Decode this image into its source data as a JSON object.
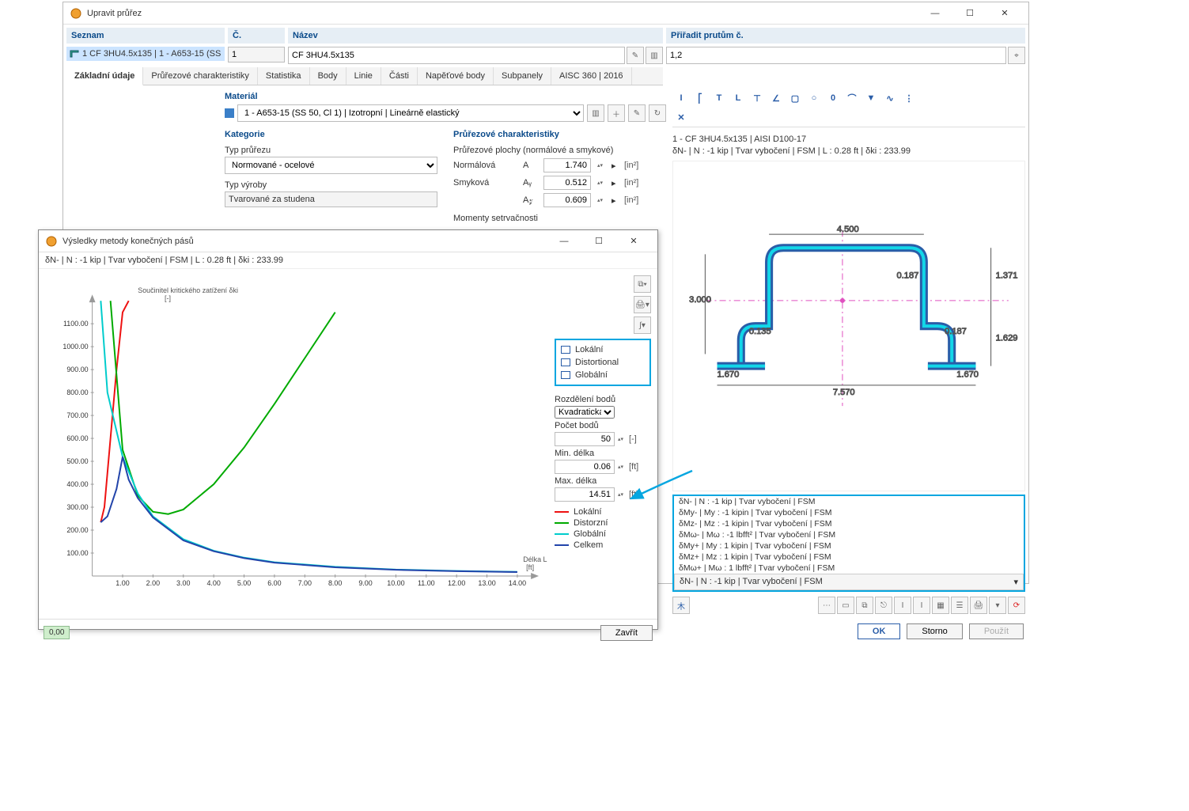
{
  "main_window": {
    "title": "Upravit průřez",
    "list_header": "Seznam",
    "list_item": "1  CF 3HU4.5x135 | 1 - A653-15 (SS",
    "number_header": "Č.",
    "number_value": "1",
    "name_header": "Název",
    "name_value": "CF 3HU4.5x135",
    "assign_header": "Přiřadit prutům č.",
    "assign_value": "1,2",
    "tabs": [
      "Základní údaje",
      "Průřezové charakteristiky",
      "Statistika",
      "Body",
      "Linie",
      "Části",
      "Napěťové body",
      "Subpanely",
      "AISC 360 | 2016"
    ],
    "material_label": "Materiál",
    "material_value": "1 - A653-15 (SS 50, Cl 1) | Izotropní | Lineárně elastický",
    "category_label": "Kategorie",
    "type_label": "Typ průřezu",
    "type_value": "Normované - ocelové",
    "manuf_label": "Typ výroby",
    "manuf_value": "Tvarované za studena",
    "props_label": "Průřezové charakteristiky",
    "areas_label": "Průřezové plochy (normálové a smykové)",
    "row_normal": "Normálová",
    "sym_A": "A",
    "val_A": "1.740",
    "row_shear": "Smyková",
    "sym_Ay": "Aᵧ",
    "val_Ay": "0.512",
    "sym_Az": "A𝓏",
    "val_Az": "0.609",
    "unit_in2": "[in²]",
    "inertia_label": "Momenty setrvačnosti",
    "section_info1": "1 - CF 3HU4.5x135 | AISI D100-17",
    "section_info2": "δN- | N : -1 kip | Tvar vybočení | FSM | L : 0.28 ft | δki : 233.99",
    "dim_top": "4.500",
    "dim_bottom": "7.570",
    "dim_left": "3.000",
    "dim_r1": "1.371",
    "dim_r2": "1.629",
    "dim_tA": "0.135",
    "dim_tB": "0.187",
    "dim_tC": "0.187",
    "dim_extL": "1.670",
    "dim_extR": "1.670",
    "results": [
      "δN- | N : -1 kip | Tvar vybočení | FSM",
      "δMy- | My : -1 kipin | Tvar vybočení | FSM",
      "δMz- | Mz : -1 kipin | Tvar vybočení | FSM",
      "δMω- | Mω : -1 lbfft² | Tvar vybočení | FSM",
      "δMy+ | My : 1 kipin | Tvar vybočení | FSM",
      "δMz+ | Mz : 1 kipin | Tvar vybočení | FSM",
      "δMω+ | Mω : 1 lbfft² | Tvar vybočení | FSM"
    ],
    "result_selected": "δN- | N : -1 kip | Tvar vybočení | FSM",
    "btn_ok": "OK",
    "btn_cancel": "Storno",
    "btn_apply": "Použít"
  },
  "fsm_window": {
    "title": "Výsledky metody konečných pásů",
    "subtitle": "δN- | N : -1 kip | Tvar vybočení | FSM | L : 0.28 ft | δki : 233.99",
    "y_axis_title": "Součinitel kritického zatížení δki",
    "y_unit": "[-]",
    "x_axis_title": "Délka L",
    "x_unit": "[ft]",
    "legend_modes": {
      "local": "Lokální",
      "distortional": "Distortional",
      "global": "Globální"
    },
    "dist_label": "Rozdělení bodů",
    "dist_value": "Kvadratická",
    "npoints_label": "Počet bodů",
    "npoints_value": "50",
    "npoints_unit": "[-]",
    "minlen_label": "Min. délka",
    "minlen_value": "0.06",
    "maxlen_label": "Max. délka",
    "maxlen_value": "14.51",
    "len_unit": "[ft]",
    "legend_series": {
      "local": "Lokální",
      "distort": "Distorzní",
      "global": "Globální",
      "total": "Celkem"
    },
    "close": "Zavřít",
    "status": "0,00"
  },
  "chart_data": {
    "type": "line",
    "title": "Součinitel kritického zatížení δki",
    "xlabel": "Délka L [ft]",
    "ylabel": "δki [-]",
    "xlim": [
      0,
      14.5
    ],
    "ylim": [
      0,
      1200
    ],
    "xticks": [
      1,
      2,
      3,
      4,
      5,
      6,
      7,
      8,
      9,
      10,
      11,
      12,
      13,
      14
    ],
    "yticks": [
      100,
      200,
      300,
      400,
      500,
      600,
      700,
      800,
      900,
      1000,
      1100
    ],
    "series": [
      {
        "name": "Lokální",
        "color": "#e11",
        "x": [
          0.28,
          0.4,
          0.6,
          0.8,
          1.0,
          1.2
        ],
        "y": [
          234,
          300,
          600,
          900,
          1150,
          1400
        ]
      },
      {
        "name": "Distorzní",
        "color": "#0a0",
        "x": [
          0.6,
          1.0,
          1.5,
          2.0,
          2.5,
          3.0,
          4.0,
          5.0,
          6.0,
          7.0,
          8.0
        ],
        "y": [
          1200,
          550,
          350,
          280,
          270,
          290,
          400,
          560,
          750,
          950,
          1150
        ]
      },
      {
        "name": "Globální",
        "color": "#0cc",
        "x": [
          0.28,
          0.5,
          1.0,
          1.5,
          2.0,
          3.0,
          4.0,
          5.0,
          6.0,
          8.0,
          10.0,
          12.0,
          14.0
        ],
        "y": [
          1200,
          800,
          520,
          360,
          260,
          160,
          110,
          80,
          60,
          40,
          28,
          22,
          18
        ]
      },
      {
        "name": "Celkem",
        "color": "#24a",
        "x": [
          0.28,
          0.5,
          0.8,
          1.0,
          1.2,
          1.5,
          2.0,
          3.0,
          4.0,
          5.0,
          6.0,
          8.0,
          10.0,
          12.0,
          14.0
        ],
        "y": [
          234,
          260,
          380,
          520,
          420,
          340,
          255,
          155,
          108,
          78,
          58,
          38,
          27,
          21,
          17
        ]
      }
    ]
  }
}
